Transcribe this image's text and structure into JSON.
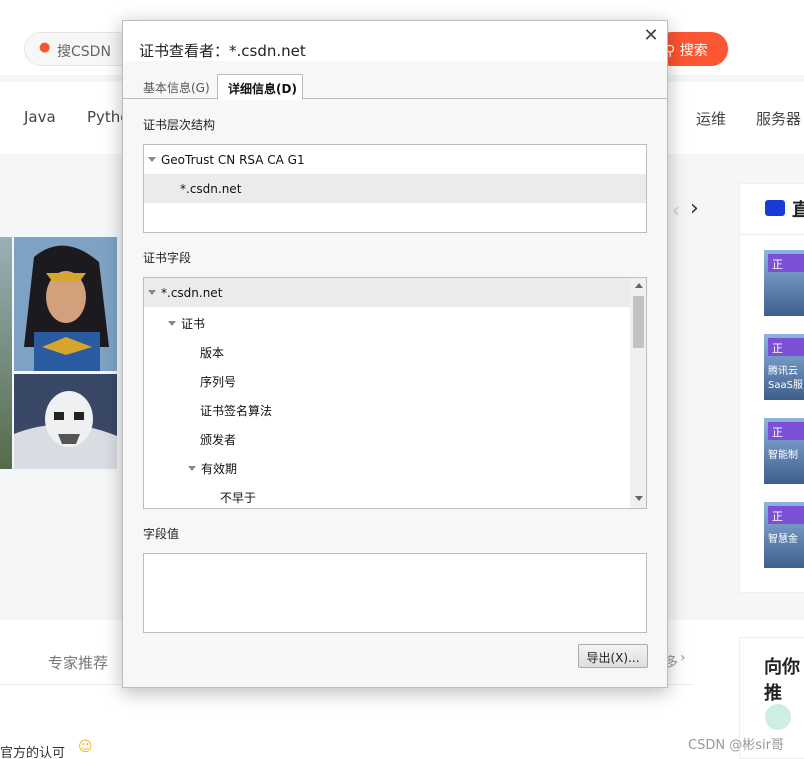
{
  "background": {
    "search_placeholder": "搜CSDN",
    "search_button": "搜索",
    "nav_items": [
      "Java",
      "Pytho",
      "运维",
      "服务器"
    ],
    "expert_label": "专家推荐",
    "more_label": "多",
    "right_heading_partial": "直",
    "right_heading2": "向你推",
    "mini_tag": "正",
    "mini_texts": [
      "",
      "腾讯云",
      "智能制",
      "智慧金"
    ],
    "mini_subtext": "SaaS服",
    "bottom_text": "官方的认可",
    "watermark": "CSDN @彬sir哥"
  },
  "dialog": {
    "title": "证书查看者：*.csdn.net",
    "close": "✕",
    "tabs": [
      {
        "label": "基本信息(G)",
        "active": false
      },
      {
        "label": "详细信息(D)",
        "active": true
      }
    ],
    "hierarchy_label": "证书层次结构",
    "hierarchy": [
      {
        "label": "GeoTrust CN RSA CA G1",
        "expanded": true,
        "selected": false
      },
      {
        "label": "*.csdn.net",
        "selected": true
      }
    ],
    "fields_label": "证书字段",
    "fields": [
      {
        "label": "*.csdn.net",
        "level": 0,
        "expanded": true,
        "selected": true
      },
      {
        "label": "证书",
        "level": 1,
        "expanded": true,
        "selected": false
      },
      {
        "label": "版本",
        "level": 2,
        "selected": false
      },
      {
        "label": "序列号",
        "level": 2,
        "selected": false
      },
      {
        "label": "证书签名算法",
        "level": 2,
        "selected": false
      },
      {
        "label": "颁发者",
        "level": 2,
        "selected": false
      },
      {
        "label": "有效期",
        "level": 2,
        "expanded": true,
        "selected": false
      },
      {
        "label": "不早于",
        "level": 3,
        "selected": false
      }
    ],
    "value_label": "字段值",
    "field_value": "",
    "export_button": "导出(X)..."
  }
}
